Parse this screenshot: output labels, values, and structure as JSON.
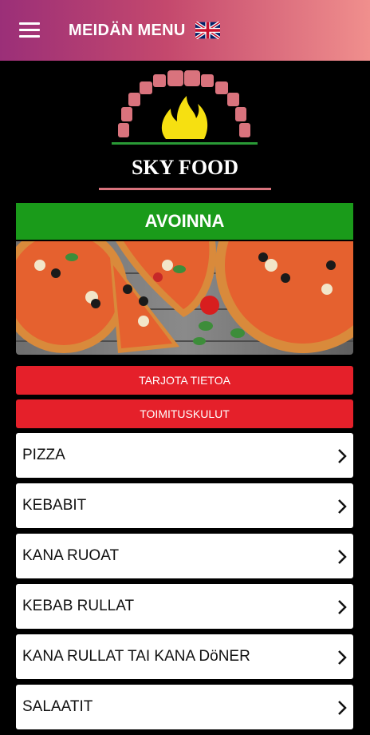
{
  "header": {
    "title": "MEIDÄN MENU",
    "menu_icon": "hamburger-menu-icon",
    "language_icon": "uk-flag-icon"
  },
  "logo": {
    "text": "SKY FOOD"
  },
  "status": {
    "label": "AVOINNA",
    "color": "#1a9b1a"
  },
  "buttons": {
    "info": "TARJOTA TIETOA",
    "delivery": "TOIMITUSKULUT",
    "color": "#e5202a"
  },
  "categories": [
    {
      "label": "PIZZA"
    },
    {
      "label": "KEBABIT"
    },
    {
      "label": "KANA RUOAT"
    },
    {
      "label": "KEBAB RULLAT"
    },
    {
      "label": "KANA RULLAT TAI KANA DöNER"
    },
    {
      "label": "SALAATIT"
    }
  ]
}
